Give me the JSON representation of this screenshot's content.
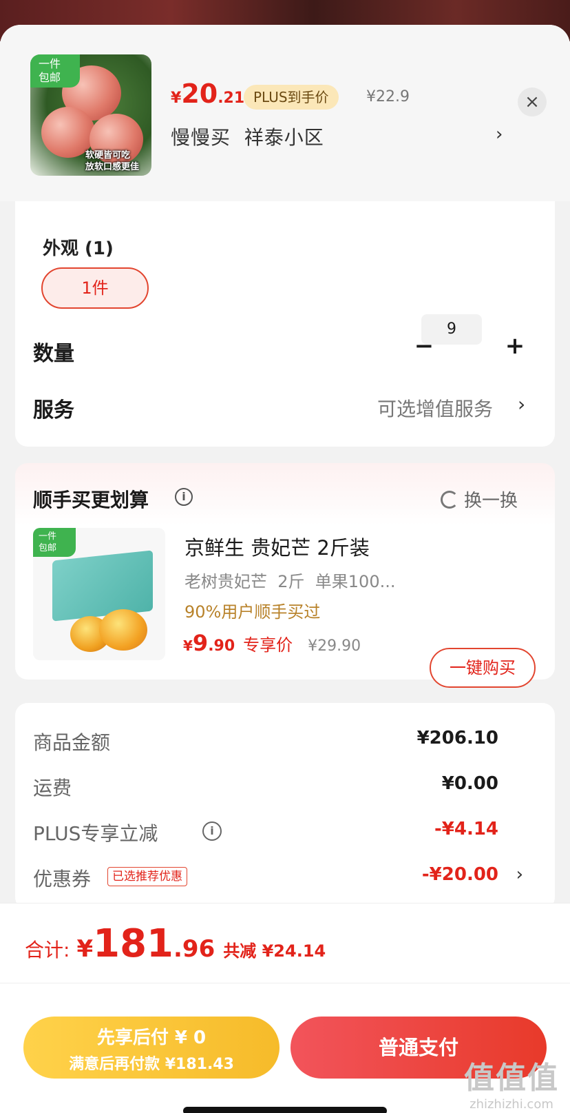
{
  "product": {
    "badge": "一件\n包邮",
    "image_caption": "软硬皆可吃\n放软口感更佳",
    "price_symbol": "¥",
    "price_int": "20",
    "price_dec": ".21",
    "plus_badge": "PLUS到手价",
    "original_price": "¥22.9",
    "address": "慢慢买  祥泰小区",
    "address_arrow": "›",
    "close": "×"
  },
  "spec": {
    "appearance_label": "外观 (1)",
    "option": "1件",
    "quantity_label": "数量",
    "quantity": "9",
    "minus": "−",
    "plus": "+",
    "service_label": "服务",
    "service_value": "可选增值服务",
    "service_arrow": "›"
  },
  "bundle": {
    "title": "顺手买更划算",
    "info": "i",
    "refresh": "换一换",
    "badge": "一件\n包邮",
    "name": "京鲜生 贵妃芒 2斤装",
    "spec": "老树贵妃芒  2斤  单果100...",
    "social": "90%用户顺手买过",
    "price_symbol": "¥",
    "price_int": "9",
    "price_dec": ".90",
    "price_tag": "专享价",
    "original_price": "¥29.90",
    "buy_label": "一键购买"
  },
  "fees": {
    "goods_label": "商品金额",
    "goods_value": "¥206.10",
    "shipping_label": "运费",
    "shipping_value": "¥0.00",
    "plus_label": "PLUS专享立减",
    "plus_info": "i",
    "plus_value": "-¥4.14",
    "coupon_label": "优惠券",
    "coupon_tag": "已选推荐优惠",
    "coupon_value": "-¥20.00",
    "coupon_arrow": "›"
  },
  "total": {
    "label": "合计:",
    "symbol": "¥",
    "int": "181",
    "dec": ".96",
    "saved": "共减 ¥24.14"
  },
  "actions": {
    "later_main": "先享后付 ¥ 0",
    "later_sub": "满意后再付款 ¥181.43",
    "pay": "普通支付"
  },
  "watermark": {
    "logo": "值值值",
    "text": "zhizhizhi.com"
  },
  "colors": {
    "accent_red": "#e2231a",
    "plus_gold": "#fbe7b8",
    "later_yellow": "#f6bb2a",
    "badge_green": "#3fb34f"
  }
}
